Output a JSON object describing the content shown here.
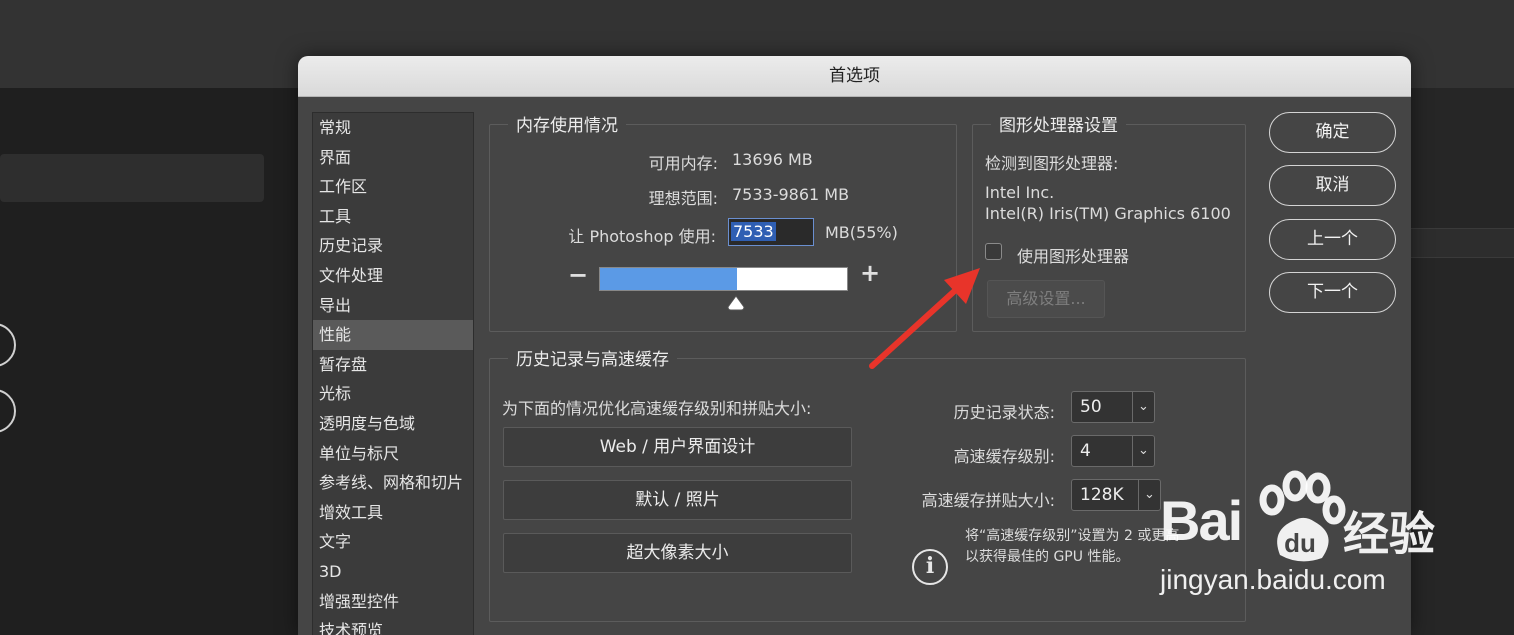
{
  "dialog": {
    "title": "首选项"
  },
  "nav": {
    "items": [
      "常规",
      "界面",
      "工作区",
      "工具",
      "历史记录",
      "文件处理",
      "导出",
      "性能",
      "暂存盘",
      "光标",
      "透明度与色域",
      "单位与标尺",
      "参考线、网格和切片",
      "增效工具",
      "文字",
      "3D",
      "增强型控件",
      "技术预览"
    ],
    "active": "性能"
  },
  "memory": {
    "title": "内存使用情况",
    "available_label": "可用内存:",
    "available_value": "13696 MB",
    "ideal_label": "理想范围:",
    "ideal_value": "7533-9861 MB",
    "use_label": "让 Photoshop 使用:",
    "use_value": "7533",
    "use_suffix": "MB(55%)",
    "slider_fraction": 0.55,
    "minus": "−",
    "plus": "+"
  },
  "gpu": {
    "title": "图形处理器设置",
    "detected_label": "检测到图形处理器:",
    "vendor": "Intel Inc.",
    "model": "Intel(R) Iris(TM) Graphics 6100",
    "use_gpu_label": "使用图形处理器",
    "use_gpu_checked": false,
    "advanced_label": "高级设置..."
  },
  "history_cache": {
    "title": "历史记录与高速缓存",
    "optimize_label": "为下面的情况优化高速缓存级别和拼贴大小:",
    "buttons": [
      "Web / 用户界面设计",
      "默认 / 照片",
      "超大像素大小"
    ],
    "history_states_label": "历史记录状态:",
    "history_states_value": "50",
    "cache_levels_label": "高速缓存级别:",
    "cache_levels_value": "4",
    "tile_size_label": "高速缓存拼贴大小:",
    "tile_size_value": "128K",
    "info_line1": "将“高速缓存级别”设置为 2 或更高",
    "info_line2": "以获得最佳的 GPU 性能。"
  },
  "actions": {
    "ok": "确定",
    "cancel": "取消",
    "prev": "上一个",
    "next": "下一个"
  },
  "watermark": {
    "brand": "Bai",
    "brand_cn": "经验",
    "url": "jingyan.baidu.com"
  },
  "colors": {
    "accent": "#5b9ae6",
    "arrow": "#e8342a"
  }
}
